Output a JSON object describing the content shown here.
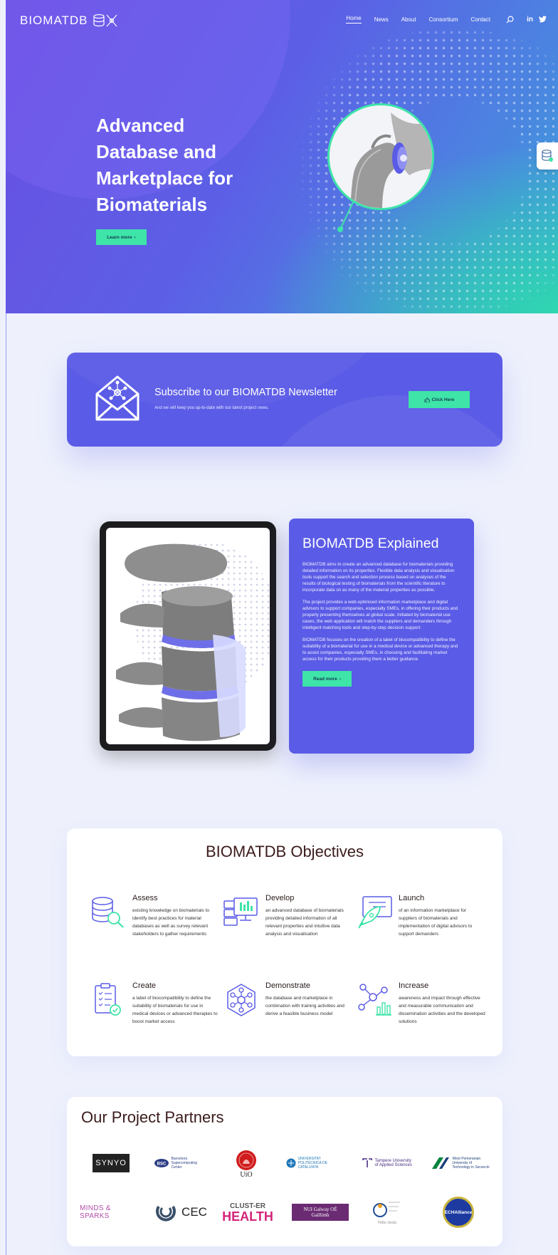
{
  "brand": {
    "name": "BIOMATDB"
  },
  "nav": {
    "items": [
      "Home",
      "News",
      "About",
      "Consortium",
      "Contact"
    ],
    "active": "Home",
    "social": [
      "in"
    ]
  },
  "hero": {
    "title_lines": [
      "Advanced",
      "Database and",
      "Marketplace for",
      "Biomaterials"
    ],
    "button": "Learn more"
  },
  "newsletter": {
    "title": "Subscribe to our BIOMATDB Newsletter",
    "subtitle": "And we will keep you up-to-date with our latest project news.",
    "button": "Click Here"
  },
  "explained": {
    "title": "BIOMATDB Explained",
    "paragraphs": [
      "BIOMATDB aims to create an advanced database for biomaterials providing detailed information on its properties. Flexible data analysis and visualisation tools support the search and selection process based on analyses of the results of biological testing of biomaterials from the scientific literature to incorporate data on as many of the material properties as possible.",
      "The project provides a web-optimised information marketplace and digital advisors to support companies, especially SMEs, in offering their products and properly presenting themselves at global scale. Initiated by biomaterial use cases, the web application will match the suppliers and demanders through intelligent matching tools and step-by-step decision support.",
      "BIOMATDB focuses on the creation of a label of biocompatibility to define the suitability of a biomaterial for use in a medical device or advanced therapy and to assist companies, especially SMEs, in choosing and facilitating market access for their products providing them a better guidance."
    ],
    "button": "Read more"
  },
  "objectives": {
    "title": "BIOMATDB Objectives",
    "items": [
      {
        "title": "Assess",
        "text": "existing knowledge on biomaterials to identify best practices for material databases as well as survey relevant stakeholders to gather requirements",
        "icon": "database-search-icon"
      },
      {
        "title": "Develop",
        "text": "an advanced database of biomaterials providing detailed information of all relevant properties and intuitive data analysis and visualisation",
        "icon": "server-monitor-icon"
      },
      {
        "title": "Launch",
        "text": "of an information marketplace for suppliers of biomaterials and implementation of digital advisors to support demanders",
        "icon": "rocket-screen-icon"
      },
      {
        "title": "Create",
        "text": "a label of biocompatibility to define the suitability of biomaterials for use in medical devices or advanced therapies to boost market access",
        "icon": "checklist-icon"
      },
      {
        "title": "Demonstrate",
        "text": "the database and marketplace in combination with training activities and derive a feasible business model",
        "icon": "network-hexagon-icon"
      },
      {
        "title": "Increase",
        "text": "awareness and impact through effective and measurable communication and dissemination activities and the developed solutions",
        "icon": "molecule-chart-icon"
      }
    ]
  },
  "partners": {
    "title": "Our Project Partners",
    "logos": {
      "synyo": "SYNYO",
      "bsc": "Barcelona Supercomputing Center",
      "uio": "UiO",
      "upv": "UNIVERSITAT POLITÈCNICA DE CATALUNYA",
      "tamk": "Tampere University of Applied Sciences",
      "zut": "West Pomeranian University of Technology in Szczecin",
      "minds": "MINDS & SPARKS",
      "cec": "CEC",
      "clust_1": "CLUST-ER",
      "clust_2": "HEALTH",
      "nui": "NUI Galway OÉ Gaillimh",
      "hnj": "Niño Jesús",
      "ech": "ECHAlliance"
    }
  },
  "colors": {
    "primary": "#5a5be6",
    "accent": "#3ee4a8",
    "background": "#eef1fc"
  }
}
